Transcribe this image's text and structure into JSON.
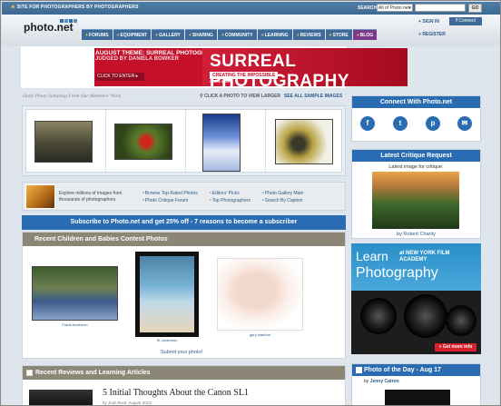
{
  "top_bar": {
    "tagline": "SITE FOR PHOTOGRAPHERS BY PHOTOGRAPHERS",
    "search_label": "SEARCH",
    "search_scope": "All of Photo.net",
    "go_label": "GO"
  },
  "header": {
    "logo": "photo.net",
    "signin": "SIGN IN",
    "connect": "Connect",
    "register": "REGISTER",
    "nav": [
      {
        "label": "FORUMS"
      },
      {
        "label": "EQUIPMENT"
      },
      {
        "label": "GALLERY"
      },
      {
        "label": "SHARING"
      },
      {
        "label": "COMMUNITY"
      },
      {
        "label": "LEARNING"
      },
      {
        "label": "REVIEWS"
      },
      {
        "label": "STORE"
      },
      {
        "label": "BLOG"
      }
    ]
  },
  "banner": {
    "theme": "AUGUST THEME: SURREAL PHOTOGRAPHY",
    "judge": "JUDGED BY DANIELA BOWKER",
    "click": "CLICK TO ENTER",
    "big_title": "SURREAL PHOTOGRAPHY",
    "sub": "CREATING THE IMPOSSIBLE",
    "name": "Daniela Bowker"
  },
  "sampling": {
    "caption": "Daily Photo Sampling From Our Members' Work",
    "click_larger": "CLICK A PHOTO TO VIEW LARGER",
    "see_all": "SEE ALL SAMPLE IMAGES"
  },
  "explore": {
    "text": "Explore millions of images from thousands of photographers",
    "links_col1": [
      "Browse Top-Rated Photos",
      "Photo Critique Forum"
    ],
    "links_col2": [
      "Editors' Picks",
      "Top Photographers"
    ],
    "links_col3": [
      "Photo Gallery Main",
      "Search By Caption"
    ]
  },
  "subscribe": "Subscribe to Photo.net and get 25% off - 7 reasons to become a subscriber",
  "contest": {
    "title": "Recent Children and Babies Contest Photos",
    "captions": [
      "Frank Anderson",
      "SL Anderson",
      "gary stanford"
    ],
    "submit": "Submit your photo!"
  },
  "reviews": {
    "title": "Recent Reviews and Learning Articles",
    "article_title": "5 Initial Thoughts About the Canon SL1",
    "article_by": "by Josh Root, August 2013"
  },
  "side": {
    "connect_title": "Connect With Photo.net",
    "social": [
      {
        "icon": "facebook-icon",
        "glyph": "f"
      },
      {
        "icon": "twitter-icon",
        "glyph": "t"
      },
      {
        "icon": "pinterest-icon",
        "glyph": "p"
      },
      {
        "icon": "email-icon",
        "glyph": "✉"
      }
    ],
    "critique_title": "Latest Critique Request",
    "critique_label": "Latest image for critique:",
    "critique_by": "by Robert Charity",
    "ad": {
      "learn": "Learn",
      "at": "at NEW YORK FILM ACADEMY",
      "photography": "Photography",
      "button": "» Get more info"
    },
    "potd_title": "Photo of the Day - Aug 17",
    "potd_by_prefix": "by",
    "potd_by": "Jenny Catron"
  },
  "colors": {
    "nav_blue": "#3d6a98",
    "blog_purple": "#7d3a8c",
    "accent_blue": "#2a6cb1",
    "banner_red": "#c5102a",
    "section_gray": "#8c8677"
  }
}
